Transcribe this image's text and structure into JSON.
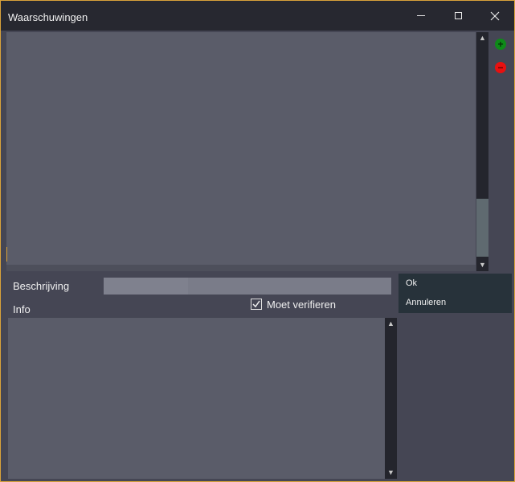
{
  "window": {
    "title": "Waarschuwingen",
    "controls": {
      "minimize": "minimize-icon",
      "maximize": "maximize-icon",
      "close": "close-icon"
    },
    "border_color": "#d9a23a"
  },
  "toolbar": {
    "add_icon": "plus-circle-icon",
    "add_color": "#0e8a18",
    "remove_icon": "minus-circle-icon",
    "remove_color": "#e81010"
  },
  "form": {
    "beschrijving_label": "Beschrijving",
    "beschrijving_value": "",
    "info_label": "Info",
    "info_value": "",
    "moet_verifieren_label": "Moet verifieren",
    "moet_verifieren_checked": true
  },
  "actions": {
    "ok_label": "Ok",
    "annuleren_label": "Annuleren"
  }
}
